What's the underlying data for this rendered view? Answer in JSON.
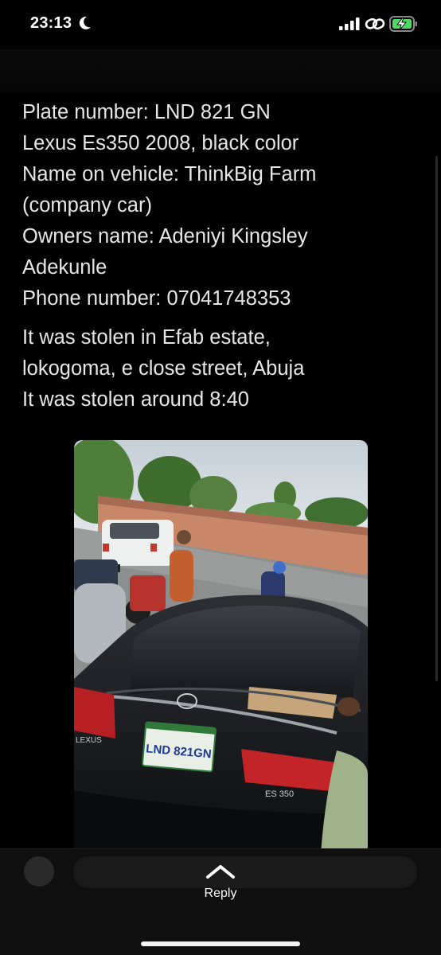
{
  "status_bar": {
    "time": "23:13",
    "icons": [
      "moon-icon",
      "signal-icon",
      "link-icon",
      "battery-charging-icon"
    ],
    "battery_color": "#4cd964"
  },
  "message": {
    "lines": [
      "Plate number: LND 821 GN",
      "Lexus Es350 2008, black color",
      "Name on vehicle: ThinkBig Farm",
      "(company car)",
      "Owners name: Adeniyi Kingsley",
      "Adekunle",
      "Phone number: 07041748353"
    ],
    "lines2": [
      "It was stolen in Efab estate,",
      "lokogoma, e close street, Abuja",
      "It was stolen around 8:40"
    ]
  },
  "photo": {
    "plate_text": "LND 821GN",
    "model_badge": "ES 350",
    "brand_text": "LEXUS"
  },
  "bottom": {
    "reply_label": "Reply"
  },
  "colors": {
    "background": "#000000",
    "text": "#e6e6e6"
  }
}
